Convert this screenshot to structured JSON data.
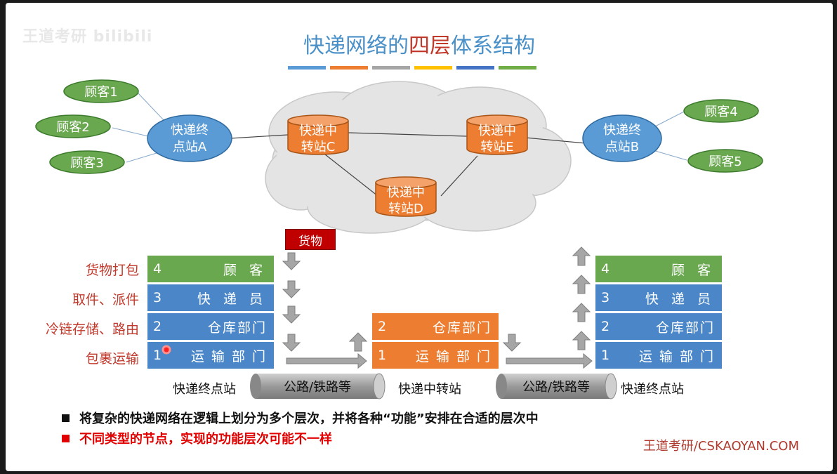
{
  "watermark": "王道考研 bilibili",
  "title": {
    "prefix": "快递网络的",
    "highlight": "四层",
    "suffix": "体系结构"
  },
  "title_bar_colors": [
    "#5b9bd5",
    "#ed7d31",
    "#a5a5a5",
    "#ffc000",
    "#4472c4",
    "#70ad47"
  ],
  "customers": [
    "顾客1",
    "顾客2",
    "顾客3",
    "顾客4",
    "顾客5"
  ],
  "terminals": {
    "a": [
      "快递终",
      "点站A"
    ],
    "b": [
      "快递终",
      "点站B"
    ]
  },
  "hubs": {
    "c": [
      "快递中",
      "转站C"
    ],
    "d": [
      "快递中",
      "转站D"
    ],
    "e": [
      "快递中",
      "转站E"
    ]
  },
  "cargo": "货物",
  "side_labels": [
    "货物打包",
    "取件、派件",
    "冷链存储、路由",
    "包裹运输"
  ],
  "layers_end": [
    {
      "num": "4",
      "label": "顾 客"
    },
    {
      "num": "3",
      "label": "快 递 员"
    },
    {
      "num": "2",
      "label": "仓库部门"
    },
    {
      "num": "1",
      "label": "运 输 部 门"
    }
  ],
  "layers_mid": [
    {
      "num": "2",
      "label": "仓库部门"
    },
    {
      "num": "1",
      "label": "运 输 部 门"
    }
  ],
  "stations": {
    "left": "快递终点站",
    "mid": "快递中转站",
    "right": "快递终点站"
  },
  "road": "公路/铁路等",
  "bullets": [
    {
      "text": "将复杂的快递网络在逻辑上划分为多个层次，并将各种“功能”安排在合适的层次中",
      "color": "#111111"
    },
    {
      "text": "不同类型的节点，实现的功能层次可能不一样",
      "color": "#e00000"
    }
  ],
  "footer": "王道考研/CSKAOYAN.COM"
}
